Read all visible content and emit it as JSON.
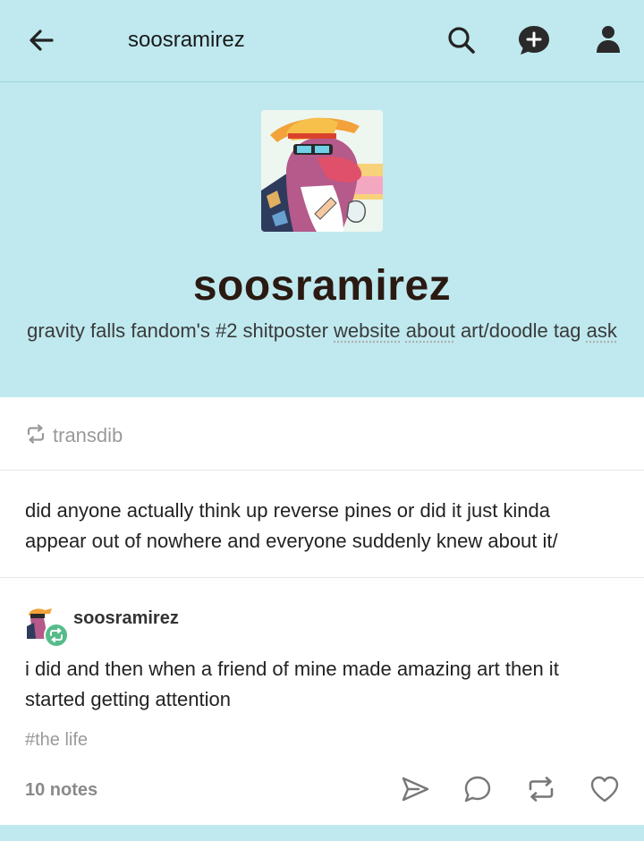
{
  "topbar": {
    "title": "soosramirez",
    "icons": [
      "back-arrow-icon",
      "search-icon",
      "new-message-icon",
      "account-icon"
    ]
  },
  "header": {
    "blog_name": "soosramirez",
    "description_prefix": "gravity falls fandom's #2 shitposter ",
    "description_word1": "website",
    "description_mid": " ",
    "description_word2": "about",
    "description_suffix": " art/doodle tag ",
    "description_word3": "ask"
  },
  "post": {
    "reblogged_from": "transdib",
    "question": "did anyone actually think up reverse pines or did it just kinda appear out of nowhere and everyone suddenly knew about it/",
    "reply_author": "soosramirez",
    "reply_text": "i did and then when a friend of mine made amazing art then it started getting attention",
    "tag": "#the life",
    "notes": "10 notes"
  },
  "colors": {
    "header_bg": "#bfe9ef",
    "card_bg": "#ffffff",
    "reblog_badge": "#56bd8a",
    "muted_text": "#9a9a9a"
  }
}
